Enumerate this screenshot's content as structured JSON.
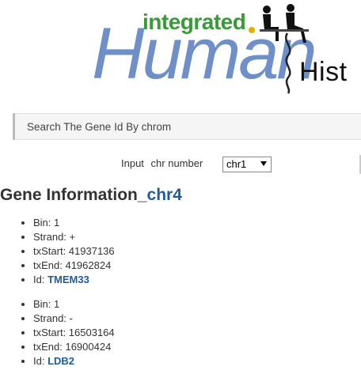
{
  "logo": {
    "small_text": "integrated",
    "main_text": "Human",
    "suffix_text": "Hist"
  },
  "search": {
    "label": "Search The Gene Id By chrom"
  },
  "input": {
    "label1": "Input",
    "label2": "chr number",
    "selected": "chr1"
  },
  "heading": {
    "prefix": "Gene Information_",
    "chrom": "chr4"
  },
  "genes": [
    {
      "bin_label": "Bin: 1",
      "strand_label": "Strand: +",
      "txstart_label": "txStart: 41937136",
      "txend_label": "txEnd: 41962824",
      "id_prefix": "Id: ",
      "id": "TMEM33"
    },
    {
      "bin_label": "Bin: 1",
      "strand_label": "Strand: -",
      "txstart_label": "txStart: 16503164",
      "txend_label": "txEnd: 16900424",
      "id_prefix": "Id: ",
      "id": "LDB2"
    }
  ]
}
